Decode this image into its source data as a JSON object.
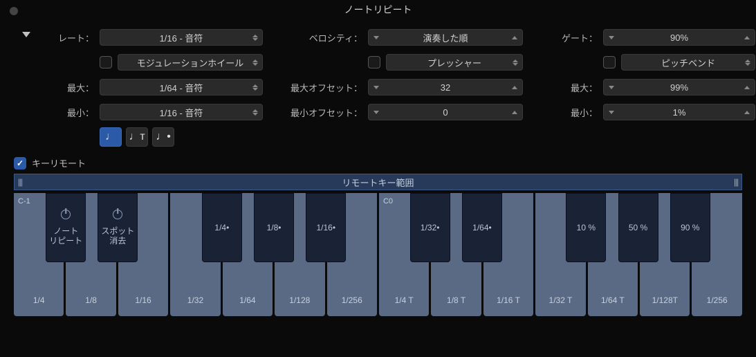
{
  "title": "ノートリピート",
  "rate": {
    "label": "レート：",
    "value": "1/16 - 音符",
    "mod_enabled": false,
    "mod_label": "モジュレーションホイール",
    "max_label": "最大：",
    "max_value": "1/64 - 音符",
    "min_label": "最小：",
    "min_value": "1/16 - 音符",
    "mode_normal": "♩",
    "mode_triplet": "♩ᴛ",
    "mode_dotted": "♩•"
  },
  "velocity": {
    "label": "ベロシティ：",
    "value": "演奏した順",
    "mod_enabled": false,
    "mod_label": "プレッシャー",
    "max_label": "最大オフセット：",
    "max_value": "32",
    "min_label": "最小オフセット：",
    "min_value": "0"
  },
  "gate": {
    "label": "ゲート：",
    "value": "90%",
    "mod_enabled": false,
    "mod_label": "ピッチベンド",
    "max_label": "最大：",
    "max_value": "99%",
    "min_label": "最小：",
    "min_value": "1%"
  },
  "remote": {
    "checked": true,
    "label": "キーリモート",
    "range_label": "リモートキー範囲"
  },
  "keyboard": {
    "white": [
      {
        "note": "C-1",
        "label": "1/4"
      },
      {
        "note": "",
        "label": "1/8"
      },
      {
        "note": "",
        "label": "1/16"
      },
      {
        "note": "",
        "label": "1/32"
      },
      {
        "note": "",
        "label": "1/64"
      },
      {
        "note": "",
        "label": "1/128"
      },
      {
        "note": "",
        "label": "1/256"
      },
      {
        "note": "C0",
        "label": "1/4 T"
      },
      {
        "note": "",
        "label": "1/8 T"
      },
      {
        "note": "",
        "label": "1/16 T"
      },
      {
        "note": "",
        "label": "1/32 T"
      },
      {
        "note": "",
        "label": "1/64 T"
      },
      {
        "note": "",
        "label": "1/128T"
      },
      {
        "note": "",
        "label": "1/256"
      }
    ],
    "black": [
      {
        "pos": 0,
        "kind": "power",
        "label": "ノート\nリピート"
      },
      {
        "pos": 1,
        "kind": "power",
        "label": "スポット\n消去"
      },
      {
        "pos": 3,
        "kind": "text",
        "label": "1/4•"
      },
      {
        "pos": 4,
        "kind": "text",
        "label": "1/8•"
      },
      {
        "pos": 5,
        "kind": "text",
        "label": "1/16•"
      },
      {
        "pos": 7,
        "kind": "text",
        "label": "1/32•"
      },
      {
        "pos": 8,
        "kind": "text",
        "label": "1/64•"
      },
      {
        "pos": 10,
        "kind": "text",
        "label": "10 %"
      },
      {
        "pos": 11,
        "kind": "text",
        "label": "50 %"
      },
      {
        "pos": 12,
        "kind": "text",
        "label": "90 %"
      }
    ]
  }
}
